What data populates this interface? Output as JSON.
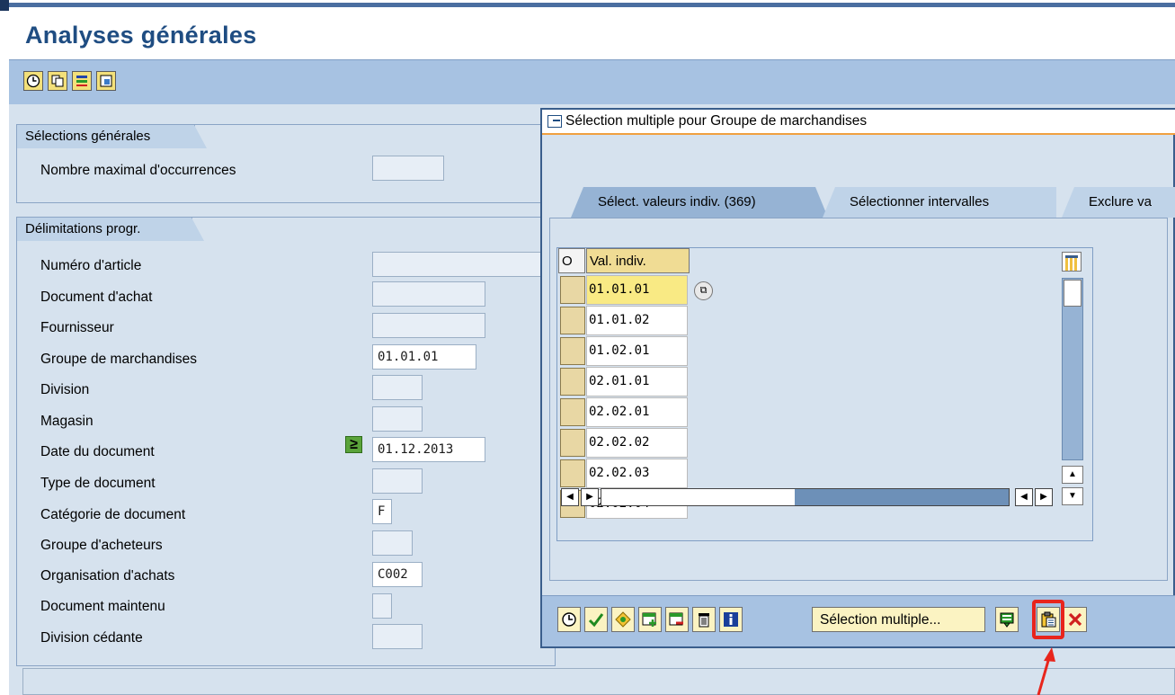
{
  "page": {
    "title": "Analyses générales"
  },
  "sections": {
    "general": {
      "title": "Sélections générales",
      "fields": [
        {
          "label": "Nombre maximal d'occurrences",
          "value": ""
        }
      ]
    },
    "delim": {
      "title": "Délimitations progr.",
      "fields": [
        {
          "label": "Numéro d'article",
          "value": ""
        },
        {
          "label": "Document d'achat",
          "value": ""
        },
        {
          "label": "Fournisseur",
          "value": ""
        },
        {
          "label": "Groupe de marchandises",
          "value": "01.01.01"
        },
        {
          "label": "Division",
          "value": ""
        },
        {
          "label": "Magasin",
          "value": ""
        },
        {
          "label": "Date du document",
          "value": "01.12.2013",
          "operator": "≥"
        },
        {
          "label": "Type de document",
          "value": ""
        },
        {
          "label": "Catégorie de document",
          "value": "F"
        },
        {
          "label": "Groupe d'acheteurs",
          "value": ""
        },
        {
          "label": "Organisation d'achats",
          "value": "C002"
        },
        {
          "label": "Document maintenu",
          "value": ""
        },
        {
          "label": "Division cédante",
          "value": ""
        }
      ]
    }
  },
  "dialog": {
    "title": "Sélection multiple pour Groupe de marchandises",
    "tabs": [
      {
        "label": "Sélect. valeurs indiv. (369)",
        "active": true
      },
      {
        "label": "Sélectionner intervalles",
        "active": false
      },
      {
        "label": "Exclure va",
        "active": false
      }
    ],
    "table": {
      "col_o": "O",
      "col_val": "Val. indiv.",
      "rows": [
        "01.01.01",
        "01.01.02",
        "01.02.01",
        "02.01.01",
        "02.02.01",
        "02.02.02",
        "02.02.03",
        "02.02.04"
      ]
    },
    "toolbar": {
      "multi_label": "Sélection multiple...",
      "icons": [
        "execute-icon",
        "check-icon",
        "variant-icon",
        "insert-row-icon",
        "delete-row-icon",
        "trash-icon",
        "info-icon",
        "import-text-icon",
        "paste-clipboard-icon",
        "cancel-icon"
      ]
    },
    "highlight_color": "#e8251c"
  },
  "app_toolbar": {
    "icons": [
      "execute-icon",
      "copy-icon",
      "structure-icon",
      "detail-icon"
    ]
  }
}
